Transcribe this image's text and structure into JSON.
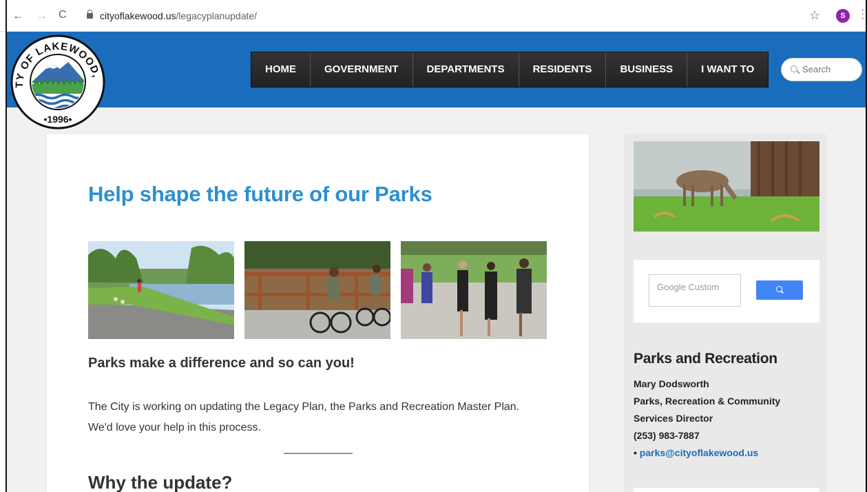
{
  "browser": {
    "back_glyph": "←",
    "forward_glyph": "→",
    "reload_glyph": "C",
    "url_host": "cityoflakewood.us",
    "url_path": "/legacyplanupdate/",
    "star_glyph": "☆",
    "profile_initial": "S",
    "icons": [
      "back-icon",
      "forward-icon",
      "reload-icon",
      "lock-icon",
      "star-icon",
      "profile-avatar",
      "menu-dots-icon"
    ]
  },
  "logo": {
    "top_text": "CITY OF LAKEWOOD, WA",
    "year": "•1996•"
  },
  "nav": {
    "items": [
      "HOME",
      "GOVERNMENT",
      "DEPARTMENTS",
      "RESIDENTS",
      "BUSINESS",
      "I WANT TO"
    ]
  },
  "search": {
    "placeholder": "Search"
  },
  "main": {
    "title": "Help shape the future of our Parks",
    "subtitle": "Parks make a difference and so can you!",
    "paragraph": "The City is working on updating the Legacy Plan, the Parks and Recreation Master Plan. We'd love your help in this process.",
    "next_heading": "Why the update?"
  },
  "sidebar": {
    "search_placeholder": "Google Custom",
    "section_title": "Parks and Recreation",
    "contact": {
      "name": "Mary Dodsworth",
      "role_line1": "Parks, Recreation & Community",
      "role_line2": "Services Director",
      "phone": "(253) 983-7887",
      "email_bullet": "•",
      "email": "parks@cityoflakewood.us"
    }
  },
  "colors": {
    "header_blue": "#1a6dbd",
    "title_blue": "#2d8fd0",
    "nav_dark": "#2b2b2b",
    "google_blue": "#4285f4"
  }
}
